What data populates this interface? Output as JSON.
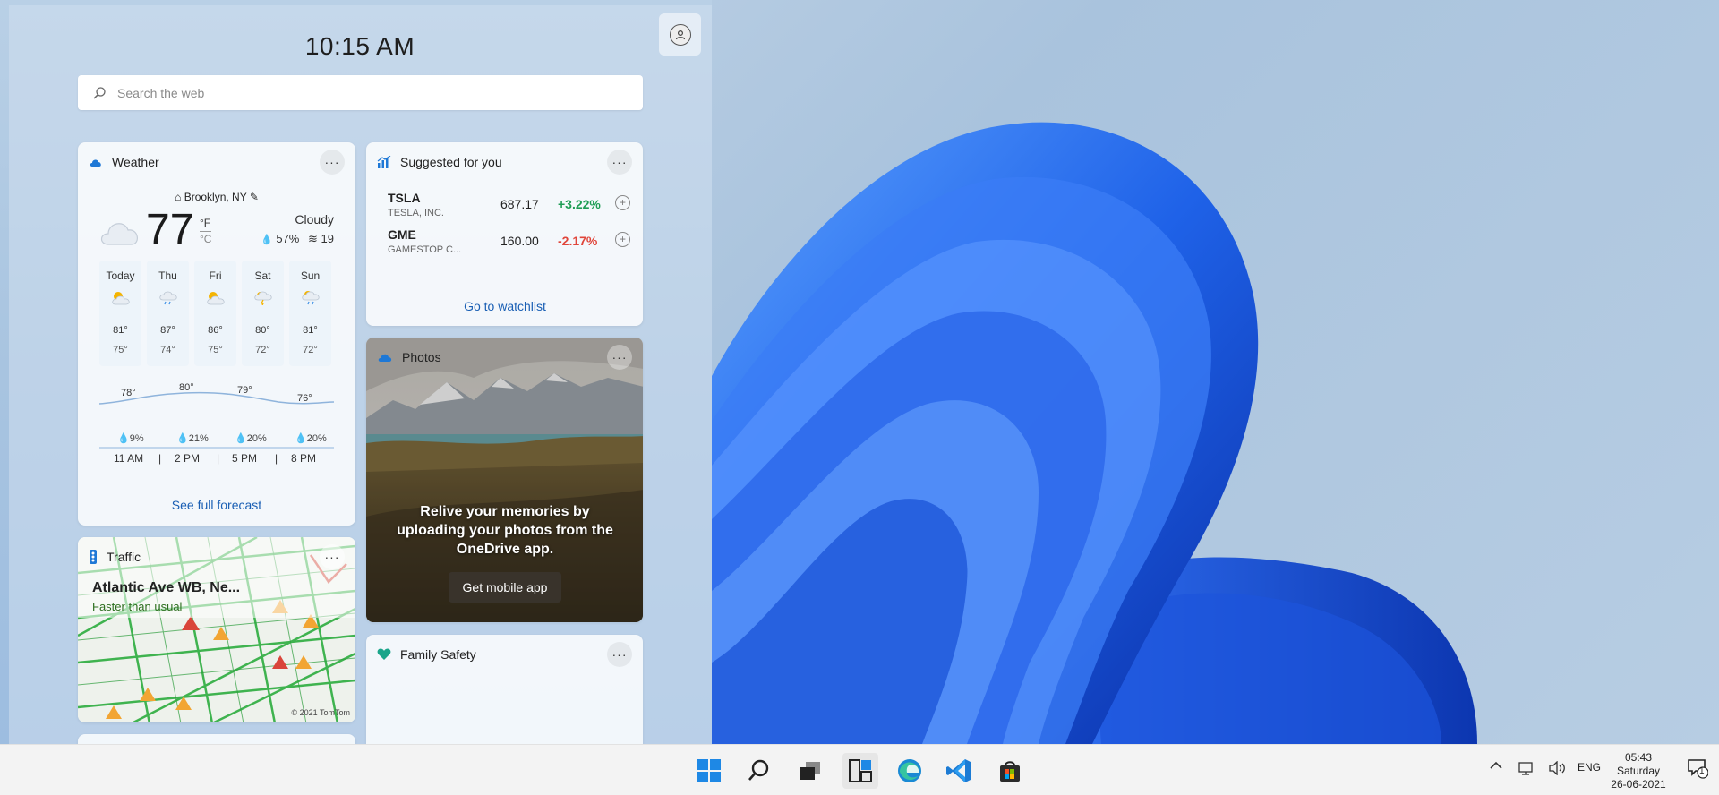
{
  "widgets": {
    "time": "10:15 AM",
    "search_placeholder": "Search the web",
    "weather": {
      "title": "Weather",
      "location": "Brooklyn, NY",
      "temperature": "77",
      "unit_f": "°F",
      "unit_c": "°C",
      "condition": "Cloudy",
      "humidity": "57%",
      "wind": "19",
      "days": [
        {
          "name": "Today",
          "hi": "81°",
          "lo": "75°",
          "icon": "partly-sunny-icon"
        },
        {
          "name": "Thu",
          "hi": "87°",
          "lo": "74°",
          "icon": "rain-icon"
        },
        {
          "name": "Fri",
          "hi": "86°",
          "lo": "75°",
          "icon": "partly-sunny-icon"
        },
        {
          "name": "Sat",
          "hi": "80°",
          "lo": "72°",
          "icon": "thunder-icon"
        },
        {
          "name": "Sun",
          "hi": "81°",
          "lo": "72°",
          "icon": "rain-sun-icon"
        }
      ],
      "hourly": [
        {
          "temp": "78°",
          "precip": "9%",
          "time": "11 AM"
        },
        {
          "temp": "80°",
          "precip": "21%",
          "time": "2 PM"
        },
        {
          "temp": "79°",
          "precip": "20%",
          "time": "5 PM"
        },
        {
          "temp": "76°",
          "precip": "20%",
          "time": "8 PM"
        }
      ],
      "see_full": "See full forecast"
    },
    "stocks": {
      "title": "Suggested for you",
      "items": [
        {
          "symbol": "TSLA",
          "name": "TESLA, INC.",
          "price": "687.17",
          "change": "+3.22%",
          "color": "#1f9d55"
        },
        {
          "symbol": "GME",
          "name": "GAMESTOP C...",
          "price": "160.00",
          "change": "-2.17%",
          "color": "#e0453a"
        }
      ],
      "watchlist": "Go to watchlist"
    },
    "photos": {
      "title": "Photos",
      "message": "Relive your memories by uploading your photos from the OneDrive app.",
      "button": "Get mobile app"
    },
    "traffic": {
      "title": "Traffic",
      "road": "Atlantic Ave WB, Ne...",
      "status": "Faster than usual",
      "copyright": "© 2021 TomTom"
    },
    "family": {
      "title": "Family Safety"
    }
  },
  "taskbar": {
    "apps": [
      "start-icon",
      "search-icon",
      "task-view-icon",
      "widgets-icon",
      "edge-icon",
      "vscode-icon",
      "store-icon"
    ],
    "language": "ENG",
    "time": "05:43",
    "day": "Saturday",
    "date": "26-06-2021",
    "notifications": "1"
  }
}
